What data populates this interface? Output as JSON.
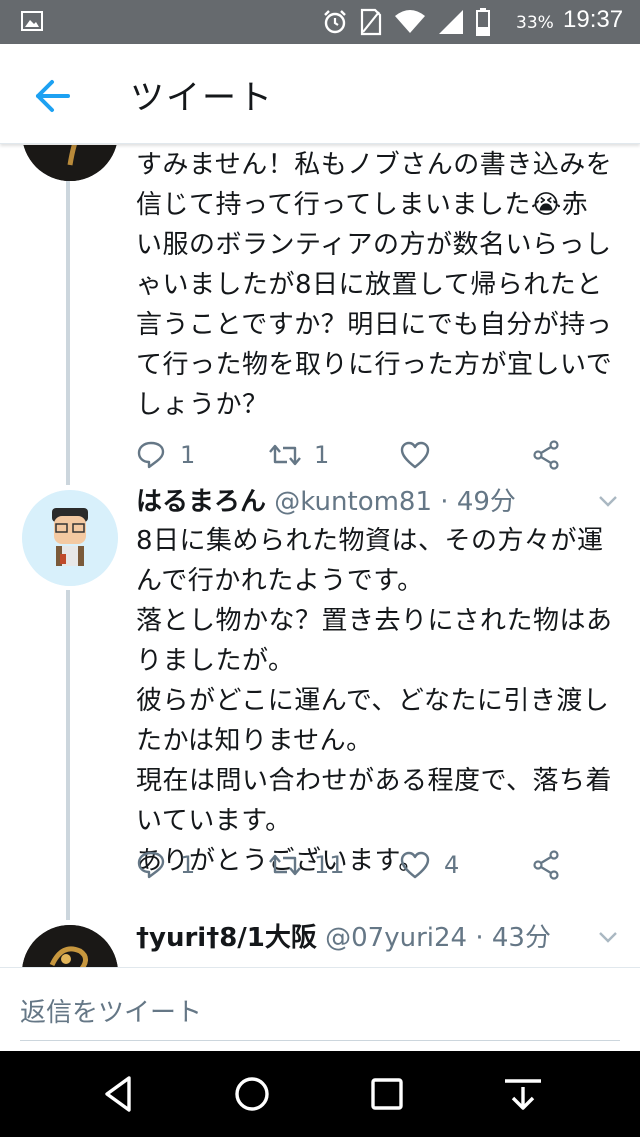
{
  "status_bar": {
    "battery_percent": "33%",
    "time": "19:37",
    "icons": [
      "gallery-icon",
      "alarm-icon",
      "no-sim-icon",
      "wifi-icon",
      "signal-icon",
      "battery-icon"
    ]
  },
  "header": {
    "title": "ツイート",
    "back_icon": "arrow-left-icon"
  },
  "tweets": [
    {
      "name_partial": "",
      "text": "すみません！私もノブさんの書き込みを\n信じて持って行ってしまいました😭赤\nい服のボランティアの方が数名いらっし\nゃいましたが8日に放置して帰られたと\n言うことですか？明日にでも自分が持っ\nて行った物を取りに行った方が宜しいで\nしょうか？",
      "replies": "1",
      "retweets": "1",
      "likes": ""
    },
    {
      "name": "はるまろん",
      "handle": "@kuntom81",
      "time": "49分",
      "text": "8日に集められた物資は、その方々が運\nんで行かれたようです。\n落とし物かな？置き去りにされた物はあ\nりましたが。\n彼らがどこに運んで、どなたに引き渡し\nたかは知りません。\n現在は問い合わせがある程度で、落ち着\nいています。\nありがとうございます。",
      "replies": "1",
      "retweets": "11",
      "likes": "4"
    },
    {
      "name": "†yuri†8/1大阪",
      "handle": "@07yuri24",
      "time": "43分"
    }
  ],
  "separator": " · ",
  "reply_bar": {
    "placeholder": "返信をツイート"
  },
  "colors": {
    "accent": "#1da1f2",
    "meta_gray": "#657786",
    "status_bar": "#666a6e"
  }
}
